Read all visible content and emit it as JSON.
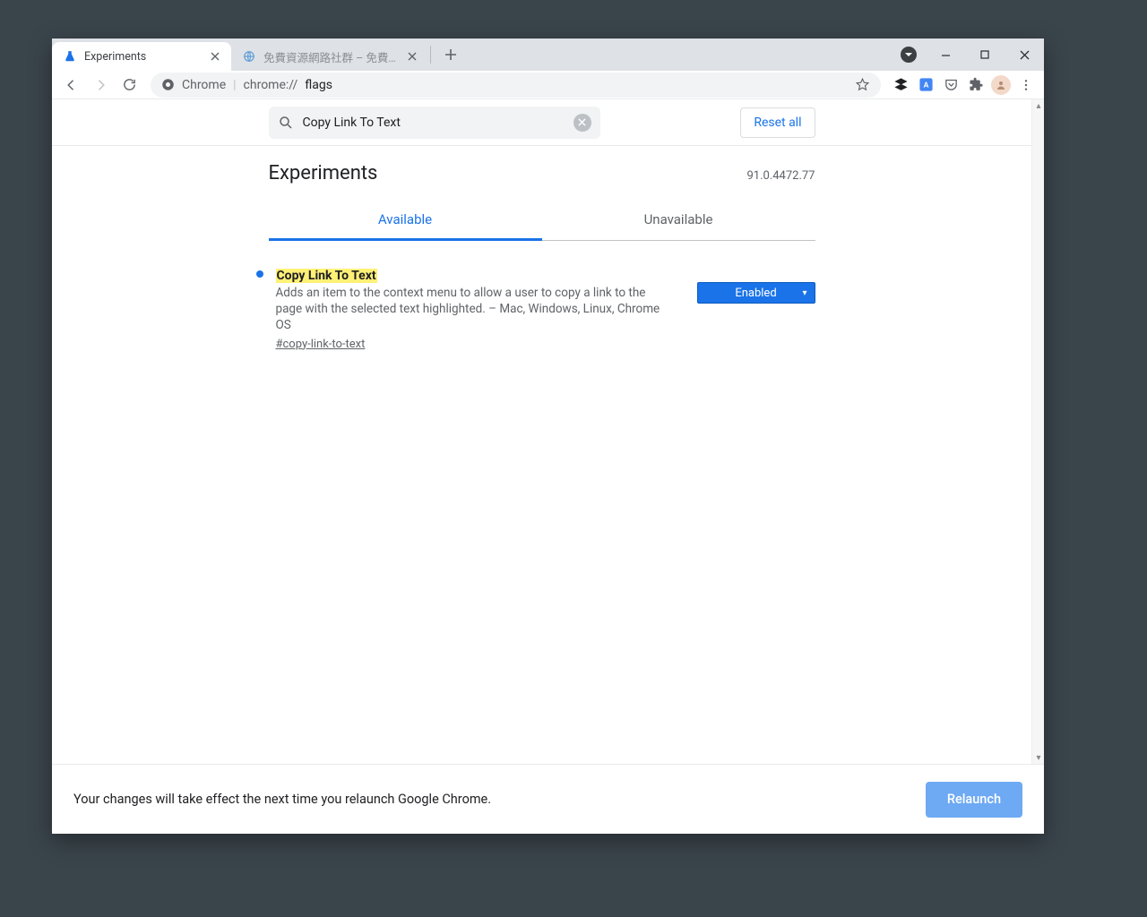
{
  "tabs": [
    {
      "title": "Experiments"
    },
    {
      "title": "免費資源網路社群 – 免費資源指南"
    }
  ],
  "address": {
    "scheme_label": "Chrome",
    "path_prefix": "chrome://",
    "path_strong": "flags"
  },
  "search": {
    "value": "Copy Link To Text"
  },
  "reset_label": "Reset all",
  "page_title": "Experiments",
  "version": "91.0.4472.77",
  "tabs2": {
    "available": "Available",
    "unavailable": "Unavailable"
  },
  "flag": {
    "title": "Copy Link To Text",
    "desc": "Adds an item to the context menu to allow a user to copy a link to the page with the selected text highlighted. – Mac, Windows, Linux, Chrome OS",
    "tag": "#copy-link-to-text",
    "state": "Enabled"
  },
  "bottom": {
    "msg": "Your changes will take effect the next time you relaunch Google Chrome.",
    "relaunch": "Relaunch"
  }
}
